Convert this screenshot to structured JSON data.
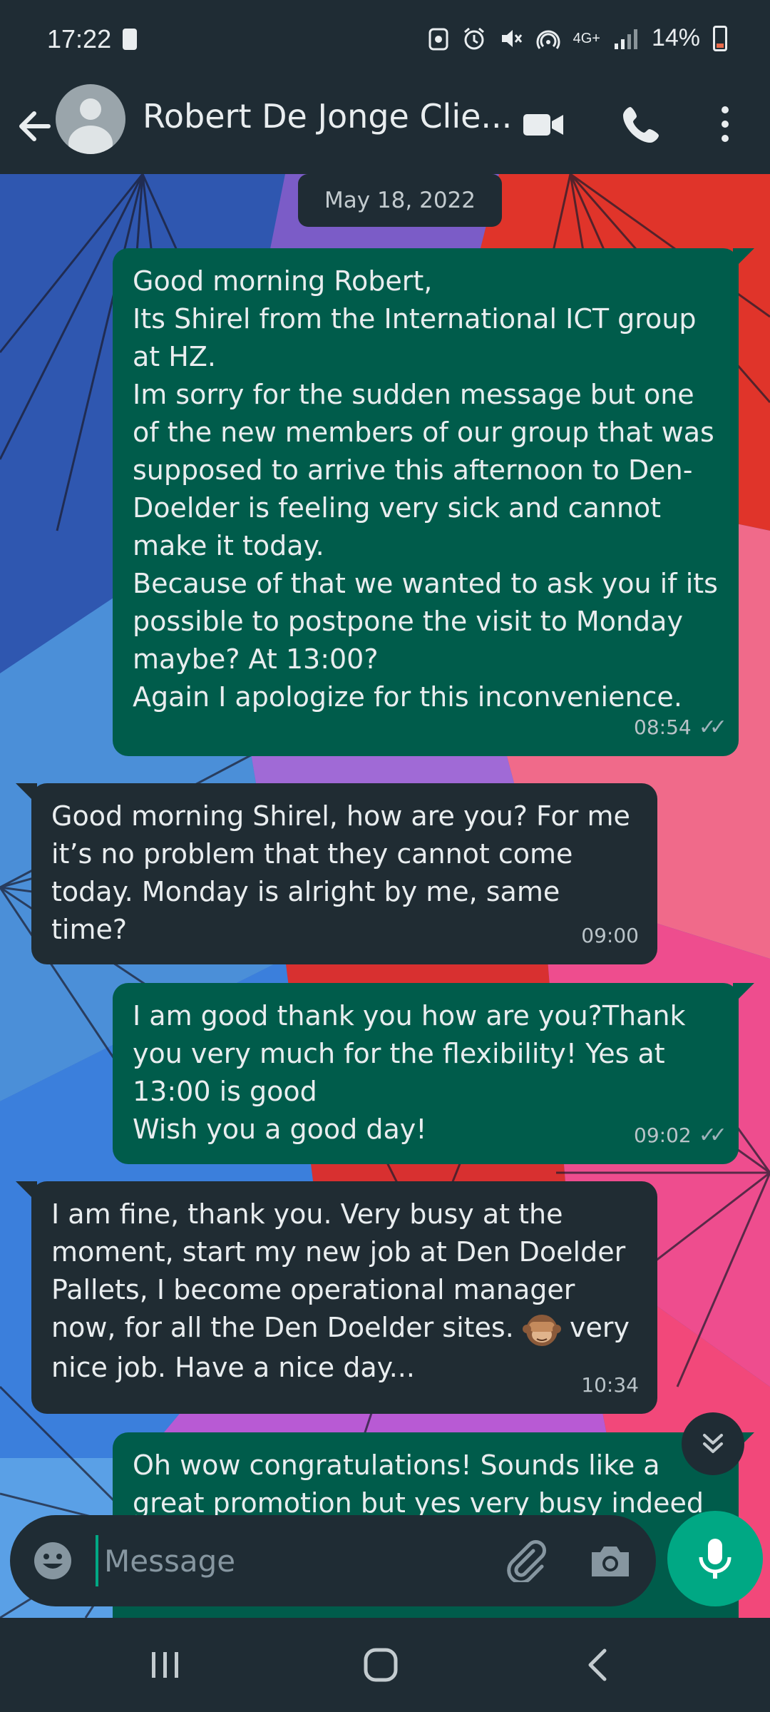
{
  "status_bar": {
    "time": "17:22",
    "network": "4G+",
    "battery": "14%"
  },
  "header": {
    "contact_name": "Robert De Jonge Clie...",
    "icons": [
      "back-arrow-icon",
      "avatar",
      "video-call-icon",
      "phone-call-icon",
      "more-options-icon"
    ]
  },
  "chat": {
    "date_chip": "May 18, 2022",
    "messages": [
      {
        "direction": "out",
        "text": "Good morning Robert,\nIts Shirel from the International ICT group at HZ.\nIm sorry for the sudden message but one of the new members of our group that was supposed to arrive this afternoon to Den-Doelder is feeling very sick and cannot make it today.\nBecause of that we wanted to ask you if its possible to postpone the visit to Monday maybe? At 13:00?\nAgain I apologize for this inconvenience.",
        "time": "08:54",
        "status": "read"
      },
      {
        "direction": "in",
        "text": "Good morning Shirel, how are you? For me it’s no problem that they cannot come today. Monday is alright by me, same time?",
        "time": "09:00"
      },
      {
        "direction": "out",
        "text": "I am good thank you how are you?Thank you very much for the flexibility! Yes at 13:00 is good\nWish you a good day!",
        "time": "09:02",
        "status": "read"
      },
      {
        "direction": "in",
        "text_before_emoji": "I am fine, thank you. Very busy at the moment, start my new job at Den Doelder Pallets, I become operational manager now, for all the Den Doelder sites. ",
        "emoji": "see-no-evil-monkey",
        "text_after_emoji": " very nice job. Have a nice day...",
        "time": "10:34"
      },
      {
        "direction": "out",
        "text": "Oh wow congratulations! Sounds like a great promotion but yes very busy indeed"
      }
    ]
  },
  "input": {
    "placeholder": "Message",
    "value": ""
  },
  "colors": {
    "header_bg": "#1f2c34",
    "outgoing_bubble": "#005c4b",
    "incoming_bubble": "#202c33",
    "accent": "#00a884"
  }
}
